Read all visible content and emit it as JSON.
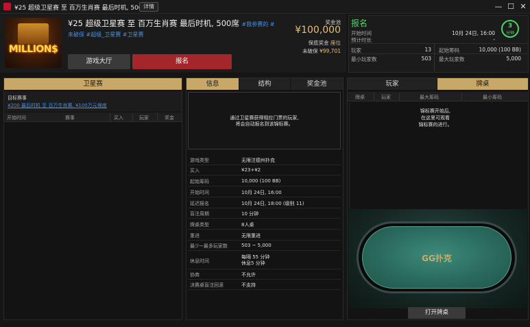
{
  "window": {
    "title": "¥25 超级卫星赛 至 百万生肖赛 最后时机, 500席",
    "details_button": "详情",
    "minimize": "—",
    "maximize": "☐",
    "close": "✕"
  },
  "header": {
    "logo_text": "MILLION$",
    "title": "¥25 超级卫星赛 至 百万生肖赛 最后时机, 500席",
    "title_link": "#我参赛的 #",
    "tags": "未破保 #超级_卫星赛 #卫星赛",
    "lobby_button": "游戏大厅",
    "register_button": "报名",
    "prize_pool_label": "奖金池",
    "prize_pool_amount": "¥100,000",
    "guarantee_label": "保底奖金",
    "guarantee_value": "座位",
    "nobreak_label": "未破保",
    "nobreak_value": "¥99,701"
  },
  "status": {
    "title": "报名",
    "start_time_label": "开始时间",
    "start_time_value": "10月 24日, 16:00",
    "est_duration_label": "预计时长",
    "est_duration_value": "-",
    "players_label": "玩家",
    "players_value": "13",
    "starting_chips_label": "起始筹码",
    "starting_chips_value": "10,000 (100 BB)",
    "min_players_label": "最小玩家数",
    "min_players_value": "503",
    "max_players_label": "最大玩家数",
    "max_players_value": "5,000",
    "clock_number": "3",
    "clock_unit": "分钟",
    "accent_color": "#4fd46a"
  },
  "left_panel": {
    "header": "卫星赛",
    "target_label": "目标赛事",
    "target_link": "¥200 最后时机 至 百万生肖赛, ¥100万元保底",
    "columns": [
      "开始时间",
      "赛事",
      "买入",
      "玩家",
      "奖金"
    ]
  },
  "middle_panel": {
    "tabs": [
      "信息",
      "结构",
      "奖金池"
    ],
    "notice": [
      "通过卫星赛获得相应门票的玩家,",
      "将会自动报名到该锦标赛。"
    ],
    "rows": [
      {
        "label": "游戏类型",
        "value": "无限注德州扑克"
      },
      {
        "label": "买入",
        "value": "¥23+¥2"
      },
      {
        "label": "起始筹码",
        "value": "10,000 (100 BB)"
      },
      {
        "label": "开始时间",
        "value": "10月 24日, 16:00"
      },
      {
        "label": "延迟报名",
        "value": "10月 24日, 18:00 (级别 11)"
      },
      {
        "label": "盲注周期",
        "value": "10 分钟"
      },
      {
        "label": "牌桌类型",
        "value": "8人桌"
      },
      {
        "label": "重进",
        "value": "无限重进"
      },
      {
        "label": "最少~最多玩家数",
        "value": "503 ~ 5,000"
      },
      {
        "label": "休息时间",
        "value": "每隔 55 分钟",
        "value2": "休息5 分钟"
      },
      {
        "label": "协商",
        "value": "不允许"
      },
      {
        "label": "决赛桌盲注回滚",
        "value": "不支持"
      }
    ]
  },
  "right_panel": {
    "tabs": [
      "玩家",
      "牌桌"
    ],
    "columns": [
      "牌桌",
      "玩家",
      "最大筹码",
      "最小筹码"
    ],
    "notice": [
      "锦标赛开始后,",
      "在这里可观看",
      "锦标赛的进行。"
    ],
    "table_logo": "GG扑克",
    "open_table_button": "打开牌桌"
  },
  "colors": {
    "gold": "#c8a868",
    "red_button": "#a3262b",
    "link_blue": "#4a90e2",
    "prize_gold": "#e5c07b"
  }
}
